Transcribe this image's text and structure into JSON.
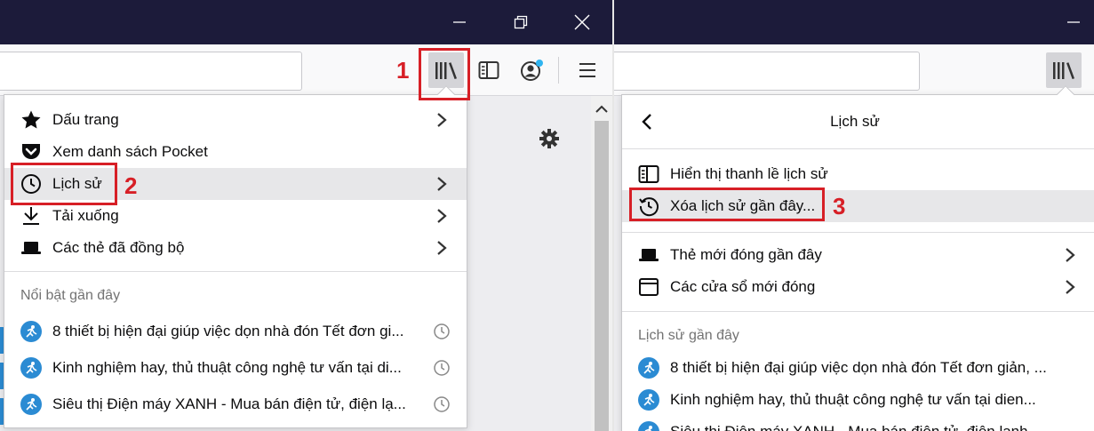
{
  "left_window": {
    "markers": {
      "library": "1",
      "history": "2"
    },
    "menu": {
      "items": [
        {
          "label": "Dấu trang",
          "icon": "star-icon"
        },
        {
          "label": "Xem danh sách Pocket",
          "icon": "pocket-icon"
        },
        {
          "label": "Lịch sử",
          "icon": "clock-icon"
        },
        {
          "label": "Tải xuống",
          "icon": "download-icon"
        },
        {
          "label": "Các thẻ đã đồng bộ",
          "icon": "synced-tabs-icon"
        }
      ],
      "section_title": "Nổi bật gần đây",
      "history": [
        "8 thiết bị hiện đại giúp việc dọn nhà đón Tết đơn gi...",
        "Kinh nghiệm hay, thủ thuật công nghệ tư vấn tại di...",
        "Siêu thị Điện máy XANH - Mua bán điện tử, điện lạ..."
      ]
    }
  },
  "right_window": {
    "marker": "3",
    "panel": {
      "title": "Lịch sử",
      "items": [
        {
          "label": "Hiển thị thanh lề lịch sử",
          "icon": "sidebar-icon"
        },
        {
          "label": "Xóa lịch sử gần đây...",
          "icon": "clear-history-icon"
        },
        {
          "label": "Thẻ mới đóng gần đây",
          "icon": "tab-icon"
        },
        {
          "label": "Các cửa sổ mới đóng",
          "icon": "window-icon"
        }
      ],
      "section_title": "Lịch sử gần đây",
      "history": [
        "8 thiết bị hiện đại giúp việc dọn nhà đón Tết đơn giản, ...",
        "Kinh nghiệm hay, thủ thuật công nghệ tư vấn tại dien...",
        "Siêu thị Điện máy XANH - Mua bán điện tử, điện lạnh..."
      ]
    }
  },
  "colors": {
    "titlebar": "#1c1b3a",
    "highlight_red": "#d71f26",
    "favicon_blue": "#2b8bd3"
  }
}
